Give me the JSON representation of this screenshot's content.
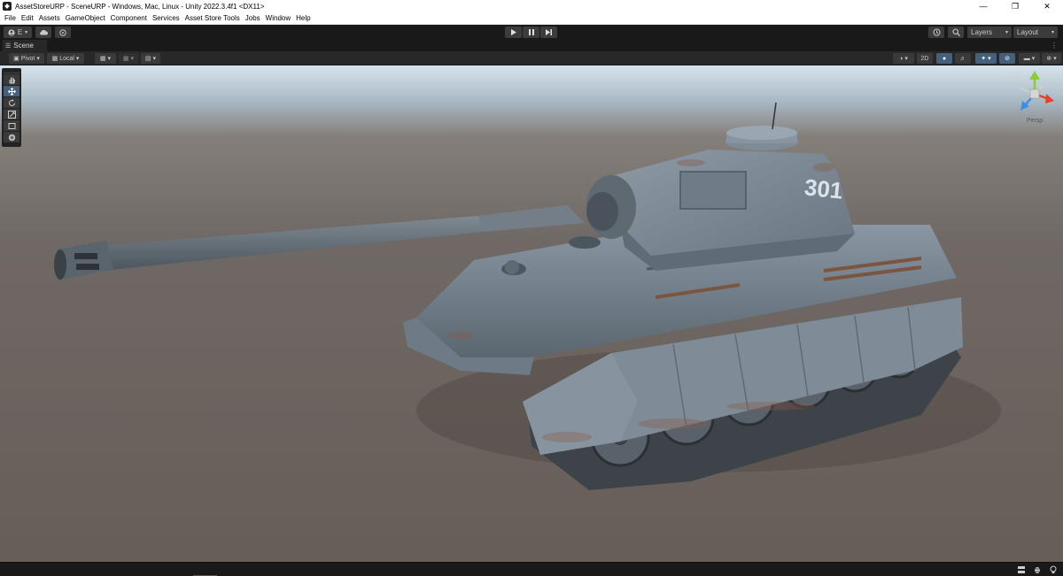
{
  "window": {
    "title": "AssetStoreURP - SceneURP - Windows, Mac, Linux - Unity 2022.3.4f1 <DX11>",
    "icon": "unity-logo-icon",
    "controls": [
      "minimize-icon",
      "restore-icon",
      "close-icon"
    ]
  },
  "menu": {
    "items": [
      "File",
      "Edit",
      "Assets",
      "GameObject",
      "Component",
      "Services",
      "Asset Store Tools",
      "Jobs",
      "Window",
      "Help"
    ]
  },
  "toolbar": {
    "account_label": "E",
    "account_icon": "account-icon",
    "cloud_icon": "cloud-icon",
    "collab_icon": "collab-icon",
    "play_icon": "play-icon",
    "pause_icon": "pause-icon",
    "step_icon": "step-icon",
    "history_icon": "history-icon",
    "search_icon": "search-icon",
    "layers_label": "Layers",
    "layout_label": "Layout"
  },
  "scene_tab": {
    "label": "Scene",
    "icon": "scene-icon"
  },
  "scene_toolbar": {
    "pivot_label": "Pivot",
    "local_label": "Local",
    "mode_2d_label": "2D",
    "accent_color": "#46607c"
  },
  "tools": [
    {
      "name": "hand-tool",
      "icon": "hand-icon"
    },
    {
      "name": "move-tool",
      "icon": "move-icon",
      "active": true
    },
    {
      "name": "rotate-tool",
      "icon": "rotate-icon"
    },
    {
      "name": "scale-tool",
      "icon": "scale-icon"
    },
    {
      "name": "rect-tool",
      "icon": "rect-icon"
    },
    {
      "name": "transform-tool",
      "icon": "transform-icon"
    }
  ],
  "gizmo": {
    "projection_label": "Persp",
    "axis_colors": {
      "x": "#e0442c",
      "y": "#8ccc3a",
      "z": "#3d8fe6"
    }
  },
  "scene": {
    "turret_marking": "301"
  }
}
